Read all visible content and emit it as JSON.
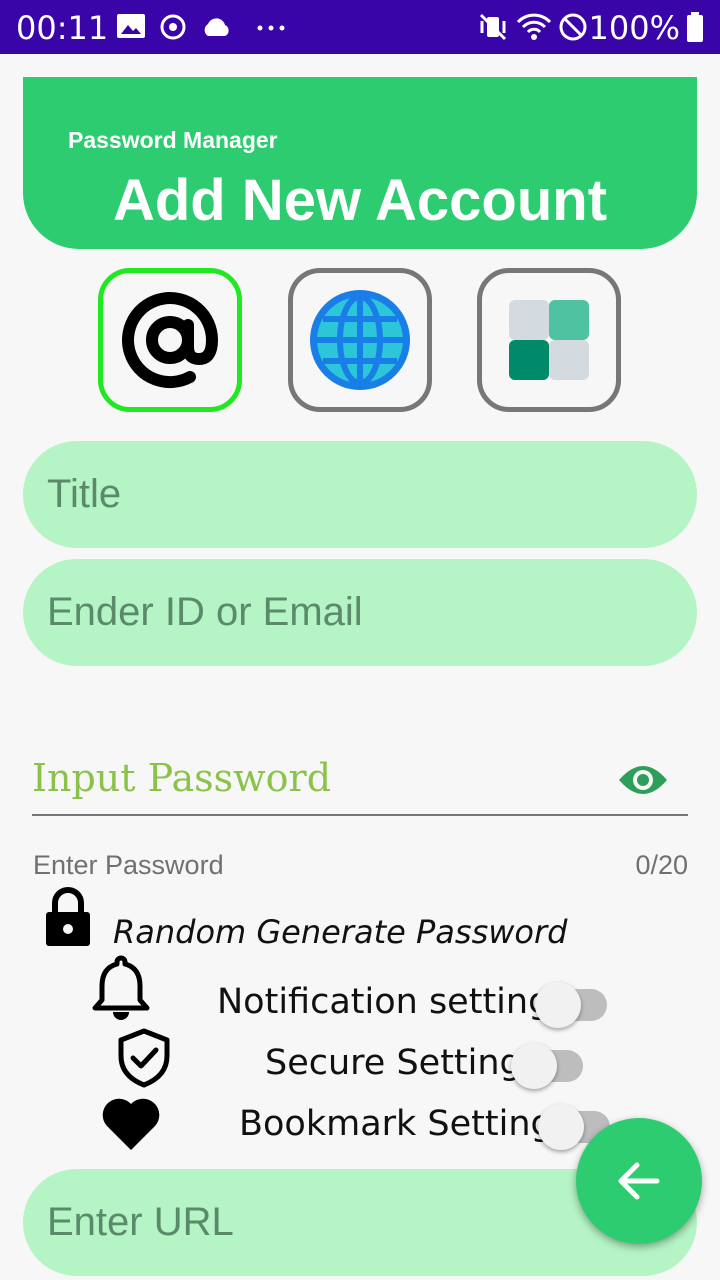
{
  "status_bar": {
    "time": "00:11",
    "battery": "100%",
    "icons": [
      "image-icon",
      "sync-icon",
      "cloud-icon",
      "more-icon",
      "vibrate-icon",
      "wifi-icon",
      "do-not-disturb-icon",
      "battery-icon"
    ]
  },
  "header": {
    "subtitle": "Password Manager",
    "title": "Add New Account",
    "color": "#2ecc71"
  },
  "categories": [
    {
      "name": "email",
      "icon": "at-sign-icon",
      "selected": true
    },
    {
      "name": "web",
      "icon": "globe-icon",
      "selected": false
    },
    {
      "name": "app",
      "icon": "app-grid-icon",
      "selected": false
    }
  ],
  "form": {
    "title_placeholder": "Title",
    "id_placeholder": "Ender ID or Email",
    "password_label": "Input Password",
    "password_helper": "Enter Password",
    "password_counter": "0/20",
    "random_label": "Random Generate Password",
    "url_placeholder": "Enter URL"
  },
  "settings": [
    {
      "label": "Notification setting",
      "icon": "bell-icon",
      "on": false
    },
    {
      "label": "Secure Setting",
      "icon": "shield-check-icon",
      "on": false
    },
    {
      "label": "Bookmark Setting",
      "icon": "heart-icon",
      "on": false
    }
  ],
  "fab": {
    "icon": "arrow-left-icon"
  }
}
